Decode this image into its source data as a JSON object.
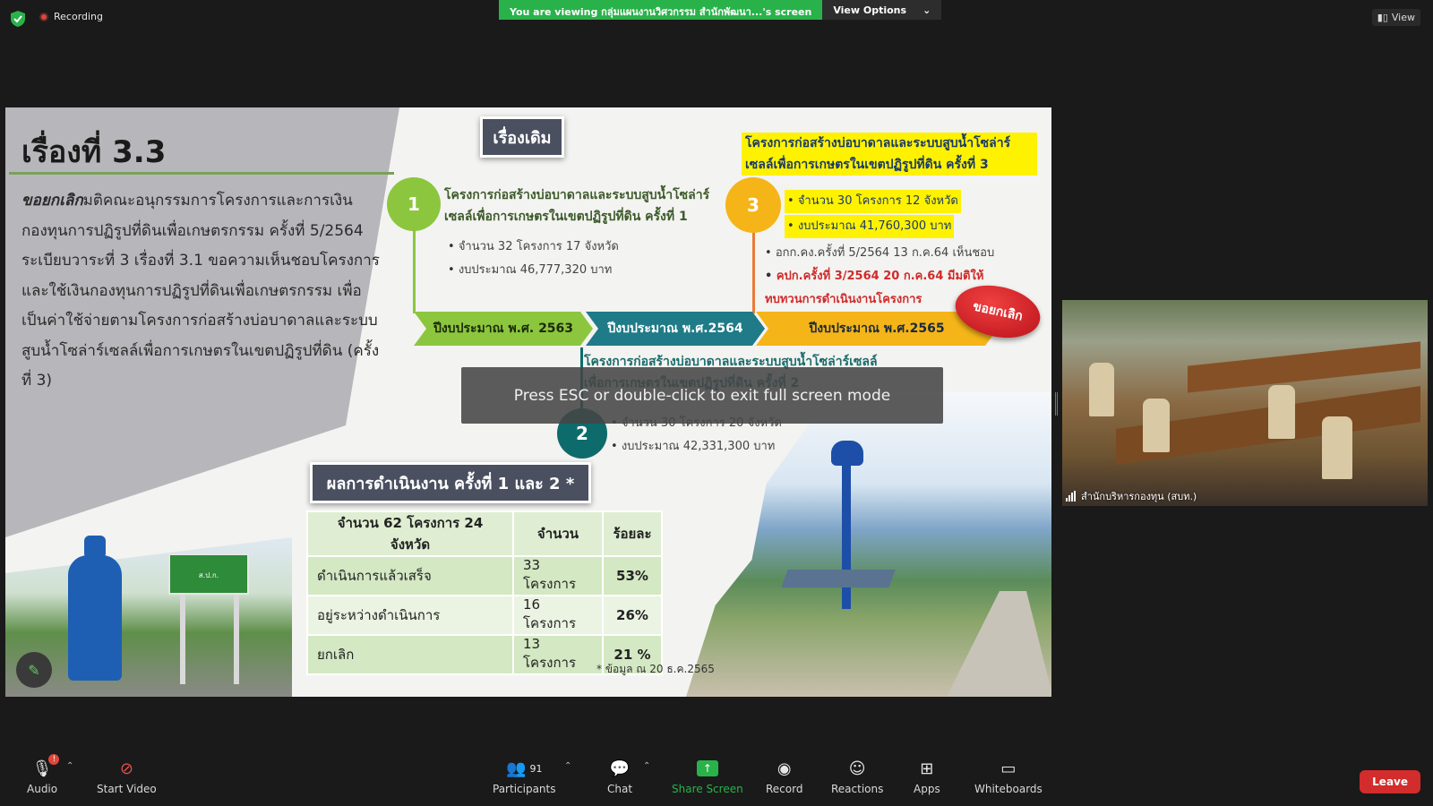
{
  "topbar": {
    "recording_label": "Recording",
    "viewing_banner": "You are viewing กลุ่มแผนงานวิศวกรรม สำนักพัฒนา...'s screen",
    "view_options_label": "View Options",
    "view_label": "View"
  },
  "slide": {
    "title": "เรื่องที่ 3.3",
    "panel_text_italic": "ขอยกเลิก",
    "panel_text": "มติคณะอนุกรรมการโครงการและการเงินกองทุนการปฏิรูปที่ดินเพื่อเกษตรกรรม ครั้งที่ 5/2564 ระเบียบวาระที่ 3 เรื่องที่ 3.1 ขอความเห็นชอบโครงการและใช้เงินกองทุนการปฏิรูปที่ดินเพื่อเกษตรกรรม เพื่อเป็นค่าใช้จ่ายตามโครงการก่อสร้างบ่อบาดาลและระบบสูบน้ำโซล่าร์เซลล์เพื่อการเกษตรในเขตปฏิรูปที่ดิน (ครั้งที่ 3)",
    "box_old": "เรื่องเดิม",
    "phase1": {
      "num": "1",
      "head": "โครงการก่อสร้างบ่อบาดาลและระบบสูบน้ำโซล่าร์เซลล์เพื่อการเกษตรในเขตปฏิรูปที่ดิน ครั้งที่ 1",
      "bullets": [
        "จำนวน 32 โครงการ 17 จังหวัด",
        "งบประมาณ 46,777,320 บาท"
      ]
    },
    "phase2": {
      "num": "2",
      "head": "โครงการก่อสร้างบ่อบาดาลและระบบสูบน้ำโซล่าร์เซลล์เพื่อการเกษตรในเขตปฏิรูปที่ดิน ครั้งที่ 2",
      "bullets": [
        "จำนวน 30 โครงการ 20 จังหวัด",
        "งบประมาณ 42,331,300 บาท"
      ]
    },
    "phase3": {
      "num": "3",
      "head": "โครงการก่อสร้างบ่อบาดาลและระบบสูบน้ำโซล่าร์เซลล์เพื่อการเกษตรในเขตปฏิรูปที่ดิน ครั้งที่ 3",
      "highlight": [
        "จำนวน 30 โครงการ 12 จังหวัด",
        "งบประมาณ 41,760,300 บาท"
      ],
      "note1": "อกก.คง.ครั้งที่ 5/2564 13 ก.ค.64 เห็นชอบ",
      "note2": "คปก.ครั้งที่ 3/2564 20 ก.ค.64 มีมติให้ทบทวนการดำเนินงานโครงการ"
    },
    "years": [
      "ปีงบประมาณ พ.ศ. 2563",
      "ปีงบประมาณ พ.ศ.2564",
      "ปีงบประมาณ พ.ศ.2565"
    ],
    "cancel_badge": "ขอยกเลิก",
    "result_title": "ผลการดำเนินงาน ครั้งที่ 1 และ 2 *",
    "table": {
      "headers": [
        "จำนวน 62 โครงการ 24 จังหวัด",
        "จำนวน",
        "ร้อยละ"
      ],
      "rows": [
        [
          "ดำเนินการแล้วเสร็จ",
          "33 โครงการ",
          "53%"
        ],
        [
          "อยู่ระหว่างดำเนินการ",
          "16 โครงการ",
          "26%"
        ],
        [
          "ยกเลิก",
          "13 โครงการ",
          "21 %"
        ]
      ]
    },
    "footnote": "* ข้อมูล ณ 20 ธ.ค.2565",
    "sign_text": "ส.ป.ก."
  },
  "fullscreen_tooltip": "Press ESC or double-click to exit full screen mode",
  "video": {
    "participant_name": "สำนักบริหารกองทุน (สบท.)"
  },
  "toolbar": {
    "audio": "Audio",
    "start_video": "Start Video",
    "participants": "Participants",
    "participants_count": "91",
    "chat": "Chat",
    "share_screen": "Share Screen",
    "record": "Record",
    "reactions": "Reactions",
    "apps": "Apps",
    "whiteboards": "Whiteboards",
    "leave": "Leave"
  },
  "colors": {
    "share_green": "#2ab24a",
    "leave_red": "#d22c2c",
    "highlight_yellow": "#fff200"
  }
}
